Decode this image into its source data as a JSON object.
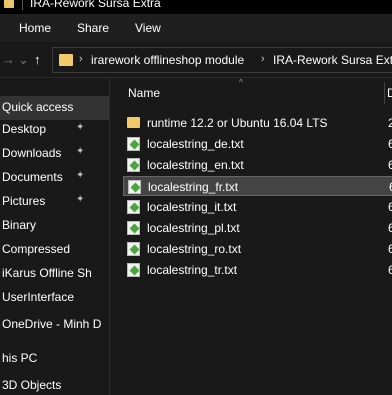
{
  "window": {
    "title": "IRA-Rework Sursa Extra"
  },
  "ribbon": {
    "tabs": [
      "Home",
      "Share",
      "View"
    ]
  },
  "address": {
    "crumbs": [
      "irarework offlineshop module",
      "IRA-Rework Sursa Extra"
    ]
  },
  "nav": {
    "items": [
      {
        "label": "Quick access",
        "selected": true,
        "pinned": false
      },
      {
        "label": "Desktop",
        "selected": false,
        "pinned": true
      },
      {
        "label": "Downloads",
        "selected": false,
        "pinned": true
      },
      {
        "label": "Documents",
        "selected": false,
        "pinned": true
      },
      {
        "label": "Pictures",
        "selected": false,
        "pinned": true
      },
      {
        "label": "Binary",
        "selected": false,
        "pinned": false
      },
      {
        "label": "Compressed",
        "selected": false,
        "pinned": false
      },
      {
        "label": "iKarus Offline Sh",
        "selected": false,
        "pinned": false
      },
      {
        "label": "UserInterface",
        "selected": false,
        "pinned": false
      },
      {
        "label": "OneDrive - Minh D",
        "selected": false,
        "pinned": false
      },
      {
        "label": "his PC",
        "selected": false,
        "pinned": false
      },
      {
        "label": "3D Objects",
        "selected": false,
        "pinned": false
      }
    ]
  },
  "content": {
    "column_name": "Name",
    "column_date_partial": "D",
    "files": [
      {
        "name": "runtime 12.2 or Ubuntu 16.04 LTS",
        "type": "folder",
        "date_partial": "2",
        "selected": false
      },
      {
        "name": "localestring_de.txt",
        "type": "txt",
        "date_partial": "6",
        "selected": false
      },
      {
        "name": "localestring_en.txt",
        "type": "txt",
        "date_partial": "6",
        "selected": false
      },
      {
        "name": "localestring_fr.txt",
        "type": "txt",
        "date_partial": "6",
        "selected": true
      },
      {
        "name": "localestring_it.txt",
        "type": "txt",
        "date_partial": "6",
        "selected": false
      },
      {
        "name": "localestring_pl.txt",
        "type": "txt",
        "date_partial": "6",
        "selected": false
      },
      {
        "name": "localestring_ro.txt",
        "type": "txt",
        "date_partial": "6",
        "selected": false
      },
      {
        "name": "localestring_tr.txt",
        "type": "txt",
        "date_partial": "6",
        "selected": false
      }
    ]
  }
}
